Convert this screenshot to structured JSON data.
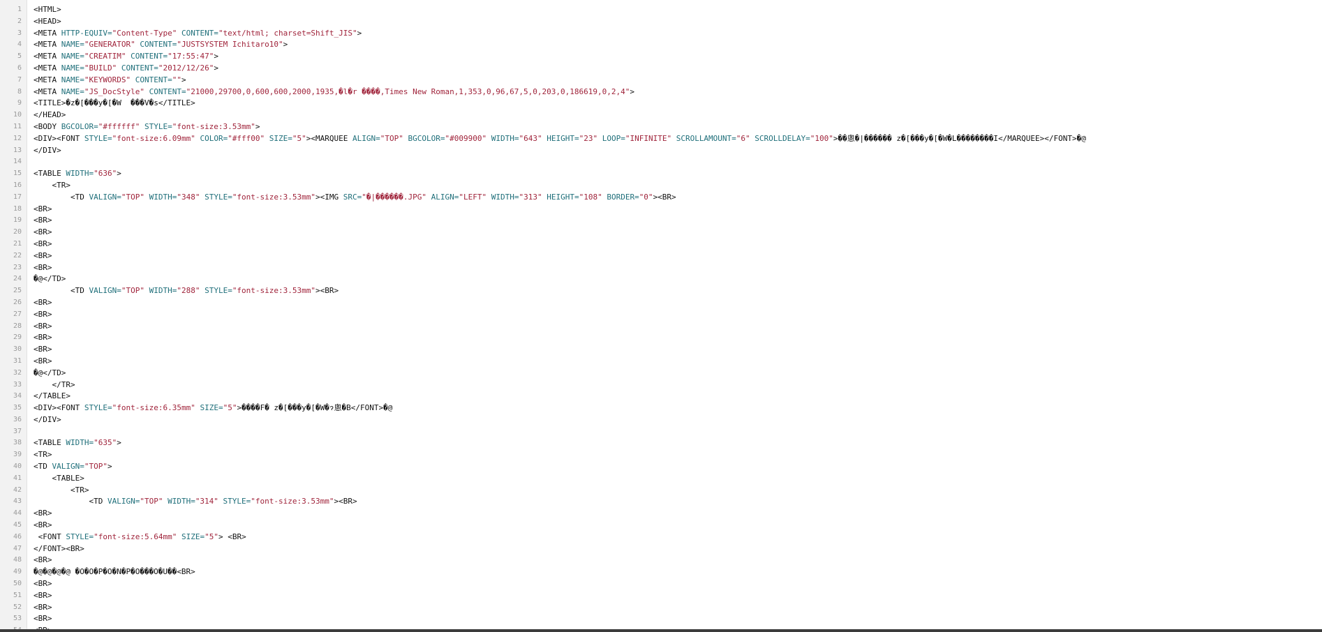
{
  "editor": {
    "colors": {
      "tag": "#111111",
      "attribute": "#1f6f7a",
      "value": "#a0243b",
      "line_number": "#9a9a9a",
      "gutter_background": "#f2f2f2"
    },
    "lines": [
      {
        "n": "1",
        "tokens": [
          {
            "t": "<HTML>",
            "k": "tag"
          }
        ]
      },
      {
        "n": "2",
        "tokens": [
          {
            "t": "<HEAD>",
            "k": "tag"
          }
        ]
      },
      {
        "n": "3",
        "tokens": [
          {
            "t": "<META ",
            "k": "tag"
          },
          {
            "t": "HTTP-EQUIV=",
            "k": "attr"
          },
          {
            "t": "\"Content-Type\"",
            "k": "val"
          },
          {
            "t": " CONTENT=",
            "k": "attr"
          },
          {
            "t": "\"text/html; charset=Shift_JIS\"",
            "k": "val"
          },
          {
            "t": ">",
            "k": "tag"
          }
        ]
      },
      {
        "n": "4",
        "tokens": [
          {
            "t": "<META ",
            "k": "tag"
          },
          {
            "t": "NAME=",
            "k": "attr"
          },
          {
            "t": "\"GENERATOR\"",
            "k": "val"
          },
          {
            "t": " CONTENT=",
            "k": "attr"
          },
          {
            "t": "\"JUSTSYSTEM Ichitaro10\"",
            "k": "val"
          },
          {
            "t": ">",
            "k": "tag"
          }
        ]
      },
      {
        "n": "5",
        "tokens": [
          {
            "t": "<META ",
            "k": "tag"
          },
          {
            "t": "NAME=",
            "k": "attr"
          },
          {
            "t": "\"CREATIM\"",
            "k": "val"
          },
          {
            "t": " CONTENT=",
            "k": "attr"
          },
          {
            "t": "\"17:55:47\"",
            "k": "val"
          },
          {
            "t": ">",
            "k": "tag"
          }
        ]
      },
      {
        "n": "6",
        "tokens": [
          {
            "t": "<META ",
            "k": "tag"
          },
          {
            "t": "NAME=",
            "k": "attr"
          },
          {
            "t": "\"BUILD\"",
            "k": "val"
          },
          {
            "t": " CONTENT=",
            "k": "attr"
          },
          {
            "t": "\"2012/12/26\"",
            "k": "val"
          },
          {
            "t": ">",
            "k": "tag"
          }
        ]
      },
      {
        "n": "7",
        "tokens": [
          {
            "t": "<META ",
            "k": "tag"
          },
          {
            "t": "NAME=",
            "k": "attr"
          },
          {
            "t": "\"KEYWORDS\"",
            "k": "val"
          },
          {
            "t": " CONTENT=",
            "k": "attr"
          },
          {
            "t": "\"\"",
            "k": "val"
          },
          {
            "t": ">",
            "k": "tag"
          }
        ]
      },
      {
        "n": "8",
        "tokens": [
          {
            "t": "<META ",
            "k": "tag"
          },
          {
            "t": "NAME=",
            "k": "attr"
          },
          {
            "t": "\"JS_DocStyle\"",
            "k": "val"
          },
          {
            "t": " CONTENT=",
            "k": "attr"
          },
          {
            "t": "\"21000,29700,0,600,600,2000,1935,�l�r ����,Times New Roman,1,353,0,96,67,5,0,203,0,186619,0,2,4\"",
            "k": "val"
          },
          {
            "t": ">",
            "k": "tag"
          }
        ]
      },
      {
        "n": "9",
        "tokens": [
          {
            "t": "<TITLE>",
            "k": "tag"
          },
          {
            "t": "�z�[���y�[�W  ���V�s",
            "k": "txt"
          },
          {
            "t": "</TITLE>",
            "k": "tag"
          }
        ]
      },
      {
        "n": "10",
        "tokens": [
          {
            "t": "</HEAD>",
            "k": "tag"
          }
        ]
      },
      {
        "n": "11",
        "tokens": [
          {
            "t": "<BODY ",
            "k": "tag"
          },
          {
            "t": "BGCOLOR=",
            "k": "attr"
          },
          {
            "t": "\"#ffffff\"",
            "k": "val"
          },
          {
            "t": " STYLE=",
            "k": "attr"
          },
          {
            "t": "\"font-size:3.53mm\"",
            "k": "val"
          },
          {
            "t": ">",
            "k": "tag"
          }
        ]
      },
      {
        "n": "12",
        "tokens": [
          {
            "t": "<DIV><FONT ",
            "k": "tag"
          },
          {
            "t": "STYLE=",
            "k": "attr"
          },
          {
            "t": "\"font-size:6.09mm\"",
            "k": "val"
          },
          {
            "t": " COLOR=",
            "k": "attr"
          },
          {
            "t": "\"#fff00\"",
            "k": "val"
          },
          {
            "t": " SIZE=",
            "k": "attr"
          },
          {
            "t": "\"5\"",
            "k": "val"
          },
          {
            "t": "><MARQUEE ",
            "k": "tag"
          },
          {
            "t": "ALIGN=",
            "k": "attr"
          },
          {
            "t": "\"TOP\"",
            "k": "val"
          },
          {
            "t": " BGCOLOR=",
            "k": "attr"
          },
          {
            "t": "\"#009900\"",
            "k": "val"
          },
          {
            "t": " WIDTH=",
            "k": "attr"
          },
          {
            "t": "\"643\"",
            "k": "val"
          },
          {
            "t": " HEIGHT=",
            "k": "attr"
          },
          {
            "t": "\"23\"",
            "k": "val"
          },
          {
            "t": " LOOP=",
            "k": "attr"
          },
          {
            "t": "\"INFINITE\"",
            "k": "val"
          },
          {
            "t": " SCROLLAMOUNT=",
            "k": "attr"
          },
          {
            "t": "\"6\"",
            "k": "val"
          },
          {
            "t": " SCROLLDELAY=",
            "k": "attr"
          },
          {
            "t": "\"100\"",
            "k": "val"
          },
          {
            "t": ">",
            "k": "tag"
          },
          {
            "t": "��悤�|������ z�[���y�[�W�L��������I",
            "k": "txt"
          },
          {
            "t": "</MARQUEE></FONT>",
            "k": "tag"
          },
          {
            "t": "�@",
            "k": "txt"
          }
        ]
      },
      {
        "n": "13",
        "tokens": [
          {
            "t": "</DIV>",
            "k": "tag"
          }
        ]
      },
      {
        "n": "14",
        "tokens": []
      },
      {
        "n": "15",
        "tokens": [
          {
            "t": "<TABLE ",
            "k": "tag"
          },
          {
            "t": "WIDTH=",
            "k": "attr"
          },
          {
            "t": "\"636\"",
            "k": "val"
          },
          {
            "t": ">",
            "k": "tag"
          }
        ]
      },
      {
        "n": "16",
        "tokens": [
          {
            "t": "    <TR>",
            "k": "tag"
          }
        ]
      },
      {
        "n": "17",
        "tokens": [
          {
            "t": "        <TD ",
            "k": "tag"
          },
          {
            "t": "VALIGN=",
            "k": "attr"
          },
          {
            "t": "\"TOP\"",
            "k": "val"
          },
          {
            "t": " WIDTH=",
            "k": "attr"
          },
          {
            "t": "\"348\"",
            "k": "val"
          },
          {
            "t": " STYLE=",
            "k": "attr"
          },
          {
            "t": "\"font-size:3.53mm\"",
            "k": "val"
          },
          {
            "t": "><IMG ",
            "k": "tag"
          },
          {
            "t": "SRC=",
            "k": "attr"
          },
          {
            "t": "\"�|������.JPG\"",
            "k": "val"
          },
          {
            "t": " ALIGN=",
            "k": "attr"
          },
          {
            "t": "\"LEFT\"",
            "k": "val"
          },
          {
            "t": " WIDTH=",
            "k": "attr"
          },
          {
            "t": "\"313\"",
            "k": "val"
          },
          {
            "t": " HEIGHT=",
            "k": "attr"
          },
          {
            "t": "\"108\"",
            "k": "val"
          },
          {
            "t": " BORDER=",
            "k": "attr"
          },
          {
            "t": "\"0\"",
            "k": "val"
          },
          {
            "t": "><BR>",
            "k": "tag"
          }
        ]
      },
      {
        "n": "18",
        "tokens": [
          {
            "t": "<BR>",
            "k": "tag"
          }
        ]
      },
      {
        "n": "19",
        "tokens": [
          {
            "t": "<BR>",
            "k": "tag"
          }
        ]
      },
      {
        "n": "20",
        "tokens": [
          {
            "t": "<BR>",
            "k": "tag"
          }
        ]
      },
      {
        "n": "21",
        "tokens": [
          {
            "t": "<BR>",
            "k": "tag"
          }
        ]
      },
      {
        "n": "22",
        "tokens": [
          {
            "t": "<BR>",
            "k": "tag"
          }
        ]
      },
      {
        "n": "23",
        "tokens": [
          {
            "t": "<BR>",
            "k": "tag"
          }
        ]
      },
      {
        "n": "24",
        "tokens": [
          {
            "t": "�@",
            "k": "txt"
          },
          {
            "t": "</TD>",
            "k": "tag"
          }
        ]
      },
      {
        "n": "25",
        "tokens": [
          {
            "t": "        <TD ",
            "k": "tag"
          },
          {
            "t": "VALIGN=",
            "k": "attr"
          },
          {
            "t": "\"TOP\"",
            "k": "val"
          },
          {
            "t": " WIDTH=",
            "k": "attr"
          },
          {
            "t": "\"288\"",
            "k": "val"
          },
          {
            "t": " STYLE=",
            "k": "attr"
          },
          {
            "t": "\"font-size:3.53mm\"",
            "k": "val"
          },
          {
            "t": "><BR>",
            "k": "tag"
          }
        ]
      },
      {
        "n": "26",
        "tokens": [
          {
            "t": "<BR>",
            "k": "tag"
          }
        ]
      },
      {
        "n": "27",
        "tokens": [
          {
            "t": "<BR>",
            "k": "tag"
          }
        ]
      },
      {
        "n": "28",
        "tokens": [
          {
            "t": "<BR>",
            "k": "tag"
          }
        ]
      },
      {
        "n": "29",
        "tokens": [
          {
            "t": "<BR>",
            "k": "tag"
          }
        ]
      },
      {
        "n": "30",
        "tokens": [
          {
            "t": "<BR>",
            "k": "tag"
          }
        ]
      },
      {
        "n": "31",
        "tokens": [
          {
            "t": "<BR>",
            "k": "tag"
          }
        ]
      },
      {
        "n": "32",
        "tokens": [
          {
            "t": "�@",
            "k": "txt"
          },
          {
            "t": "</TD>",
            "k": "tag"
          }
        ]
      },
      {
        "n": "33",
        "tokens": [
          {
            "t": "    </TR>",
            "k": "tag"
          }
        ]
      },
      {
        "n": "34",
        "tokens": [
          {
            "t": "</TABLE>",
            "k": "tag"
          }
        ]
      },
      {
        "n": "35",
        "tokens": [
          {
            "t": "<DIV><FONT ",
            "k": "tag"
          },
          {
            "t": "STYLE=",
            "k": "attr"
          },
          {
            "t": "\"font-size:6.35mm\"",
            "k": "val"
          },
          {
            "t": " SIZE=",
            "k": "attr"
          },
          {
            "t": "\"5\"",
            "k": "val"
          },
          {
            "t": ">",
            "k": "tag"
          },
          {
            "t": "����F� z�[���y�[�W�ɂ悤�B",
            "k": "txt"
          },
          {
            "t": "</FONT>",
            "k": "tag"
          },
          {
            "t": "�@",
            "k": "txt"
          }
        ]
      },
      {
        "n": "36",
        "tokens": [
          {
            "t": "</DIV>",
            "k": "tag"
          }
        ]
      },
      {
        "n": "37",
        "tokens": []
      },
      {
        "n": "38",
        "tokens": [
          {
            "t": "<TABLE ",
            "k": "tag"
          },
          {
            "t": "WIDTH=",
            "k": "attr"
          },
          {
            "t": "\"635\"",
            "k": "val"
          },
          {
            "t": ">",
            "k": "tag"
          }
        ]
      },
      {
        "n": "39",
        "tokens": [
          {
            "t": "<TR>",
            "k": "tag"
          }
        ]
      },
      {
        "n": "40",
        "tokens": [
          {
            "t": "<TD ",
            "k": "tag"
          },
          {
            "t": "VALIGN=",
            "k": "attr"
          },
          {
            "t": "\"TOP\"",
            "k": "val"
          },
          {
            "t": ">",
            "k": "tag"
          }
        ]
      },
      {
        "n": "41",
        "tokens": [
          {
            "t": "    <TABLE>",
            "k": "tag"
          }
        ]
      },
      {
        "n": "42",
        "tokens": [
          {
            "t": "        <TR>",
            "k": "tag"
          }
        ]
      },
      {
        "n": "43",
        "tokens": [
          {
            "t": "            <TD ",
            "k": "tag"
          },
          {
            "t": "VALIGN=",
            "k": "attr"
          },
          {
            "t": "\"TOP\"",
            "k": "val"
          },
          {
            "t": " WIDTH=",
            "k": "attr"
          },
          {
            "t": "\"314\"",
            "k": "val"
          },
          {
            "t": " STYLE=",
            "k": "attr"
          },
          {
            "t": "\"font-size:3.53mm\"",
            "k": "val"
          },
          {
            "t": "><BR>",
            "k": "tag"
          }
        ]
      },
      {
        "n": "44",
        "tokens": [
          {
            "t": "<BR>",
            "k": "tag"
          }
        ]
      },
      {
        "n": "45",
        "tokens": [
          {
            "t": "<BR>",
            "k": "tag"
          }
        ]
      },
      {
        "n": "46",
        "tokens": [
          {
            "t": " <FONT ",
            "k": "tag"
          },
          {
            "t": "STYLE=",
            "k": "attr"
          },
          {
            "t": "\"font-size:5.64mm\"",
            "k": "val"
          },
          {
            "t": " SIZE=",
            "k": "attr"
          },
          {
            "t": "\"5\"",
            "k": "val"
          },
          {
            "t": "> <BR>",
            "k": "tag"
          }
        ]
      },
      {
        "n": "47",
        "tokens": [
          {
            "t": "</FONT><BR>",
            "k": "tag"
          }
        ]
      },
      {
        "n": "48",
        "tokens": [
          {
            "t": "<BR>",
            "k": "tag"
          }
        ]
      },
      {
        "n": "49",
        "tokens": [
          {
            "t": "�@�@�@�@ �O�O�P�O�N�P�O���O�U��",
            "k": "txt"
          },
          {
            "t": "<BR>",
            "k": "tag"
          }
        ]
      },
      {
        "n": "50",
        "tokens": [
          {
            "t": "<BR>",
            "k": "tag"
          }
        ]
      },
      {
        "n": "51",
        "tokens": [
          {
            "t": "<BR>",
            "k": "tag"
          }
        ]
      },
      {
        "n": "52",
        "tokens": [
          {
            "t": "<BR>",
            "k": "tag"
          }
        ]
      },
      {
        "n": "53",
        "tokens": [
          {
            "t": "<BR>",
            "k": "tag"
          }
        ]
      },
      {
        "n": "54",
        "tokens": [
          {
            "t": "<BR>",
            "k": "tag"
          }
        ]
      }
    ]
  }
}
